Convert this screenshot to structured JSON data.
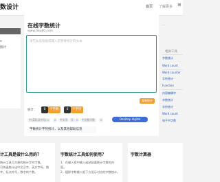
{
  "header": {
    "brand": "数设计",
    "nav_home": "首页",
    "nav_more": "了解更多"
  },
  "sidebar": {
    "items": [
      {
        "label": ""
      },
      {
        "label": "e"
      },
      {
        "label": "统计"
      }
    ]
  },
  "main": {
    "title": "在线字数统计",
    "url": "www.tiku80.com",
    "placeholder": "请在此处粘贴或输入您想要统计的文本",
    "stats_label": "统计：",
    "count1": "0",
    "unit1": "个字数",
    "count2": "0",
    "unit2": "个字符",
    "chips": [
      "中/英标点符号(1)",
      "0",
      "中文字",
      "字",
      "0",
      "中文数字数",
      "0"
    ],
    "digital_btn": "Desktop digital conversion",
    "note": "字数统计字符统计，以及其他帮助信息"
  },
  "right": {
    "items": [
      {
        "label": "相关工具"
      },
      {
        "label": "字数统计"
      },
      {
        "label": "Word count"
      },
      {
        "label": "Word counter"
      },
      {
        "label": "字符统计"
      },
      {
        "label": "Function"
      },
      {
        "label": "内容编辑字"
      },
      {
        "label": "字数统计"
      },
      {
        "label": "字符统计"
      },
      {
        "label": "Word count"
      },
      {
        "label": "电子书字数"
      }
    ]
  },
  "cards": [
    {
      "title": "计工具是做什么用的？",
      "lines": [
        "统计工具可方便的统计字符字数。",
        "可快速统计出中文汉字，英文字母，数",
        "字，标点符号，数字的个数。"
      ]
    },
    {
      "title": "字数统计工具如何使用？",
      "lines": [
        "1、在输入框中输入或粘贴要统计字数的内",
        "容。",
        "2、随即字数输入框下方显示对应的字数统计。"
      ]
    },
    {
      "title": "字数计算器",
      "lines": []
    }
  ]
}
